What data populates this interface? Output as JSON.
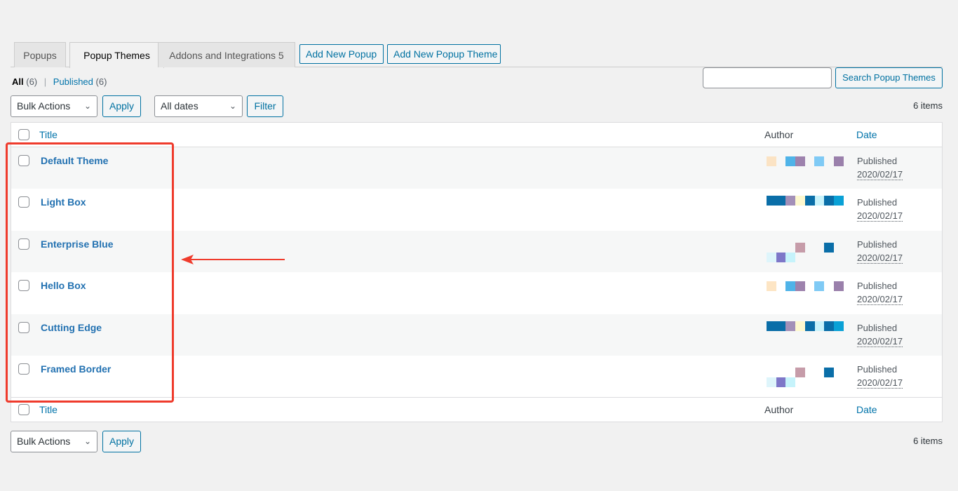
{
  "tabs": [
    {
      "label": "Popups",
      "active": false
    },
    {
      "label": "Popup Themes",
      "active": true
    },
    {
      "label": "Addons and Integrations 5",
      "active": false
    }
  ],
  "actions": {
    "add_new_popup": "Add New Popup",
    "add_new_popup_theme": "Add New Popup Theme"
  },
  "views": {
    "all_label": "All",
    "all_count": "(6)",
    "separator": "|",
    "published_label": "Published",
    "published_count": "(6)"
  },
  "search": {
    "value": "",
    "placeholder": "",
    "button_label": "Search Popup Themes"
  },
  "tablenav_top": {
    "bulk_actions": "Bulk Actions",
    "apply": "Apply",
    "dates": "All dates",
    "filter": "Filter",
    "items_count": "6 items"
  },
  "tablenav_bottom": {
    "bulk_actions": "Bulk Actions",
    "apply": "Apply",
    "items_count": "6 items"
  },
  "table": {
    "columns": {
      "title": "Title",
      "author": "Author",
      "date": "Date"
    },
    "rows": [
      {
        "title": "Default Theme",
        "author": "[redacted]",
        "status": "Published",
        "date": "2020/02/17"
      },
      {
        "title": "Light Box",
        "author": "[redacted]",
        "status": "Published",
        "date": "2020/02/17"
      },
      {
        "title": "Enterprise Blue",
        "author": "[redacted]",
        "status": "Published",
        "date": "2020/02/17"
      },
      {
        "title": "Hello Box",
        "author": "[redacted]",
        "status": "Published",
        "date": "2020/02/17"
      },
      {
        "title": "Cutting Edge",
        "author": "[redacted]",
        "status": "Published",
        "date": "2020/02/17"
      },
      {
        "title": "Framed Border",
        "author": "[redacted]",
        "status": "Published",
        "date": "2020/02/17"
      }
    ]
  },
  "colors": {
    "link": "#0073aa",
    "annotation": "#ef3b2c",
    "background": "#f1f1f1"
  },
  "icons": {
    "select_chevron": "chevron-down-icon",
    "annotation_arrow": "arrow-left-icon"
  }
}
